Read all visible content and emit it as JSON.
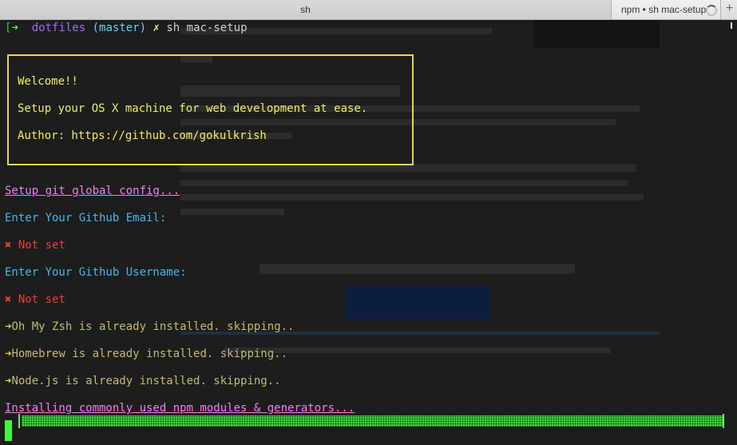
{
  "tabs": [
    {
      "label": "sh"
    },
    {
      "label": "npm • sh mac-setup"
    }
  ],
  "colors": {
    "prompt_arrow": "#5ff25f",
    "dir": "#a46bff",
    "branch": "#5fd7ff",
    "box_border": "#e5d84a",
    "heading": "#f27ff2",
    "prompt_label": "#45b8e8",
    "error": "#e5403a",
    "info": "#dcd13e",
    "progress": "#3cdb3c"
  },
  "terminal": {
    "prompt": {
      "arrow": "➜",
      "dir": "dotfiles",
      "branch": "(master)",
      "dirty": "✗",
      "command": "sh mac-setup"
    },
    "banner": {
      "welcome": "Welcome!!",
      "tagline": "Setup your OS X machine for web development at ease.",
      "author": "Author: https://github.com/gokulkrish"
    },
    "git_heading": "Setup git global config...",
    "email_prompt": "Enter Your Github Email:",
    "email_status": "Not set",
    "username_prompt": "Enter Your Github Username:",
    "username_status": "Not set",
    "cross_icon": "✖",
    "info_arrow": "➜",
    "zsh_msg": "Oh My Zsh is already installed. skipping..",
    "brew_msg": "Homebrew is already installed. skipping..",
    "node_msg": "Node.js is already installed. skipping..",
    "npm_heading": "Installing commonly used npm modules & generators..."
  }
}
